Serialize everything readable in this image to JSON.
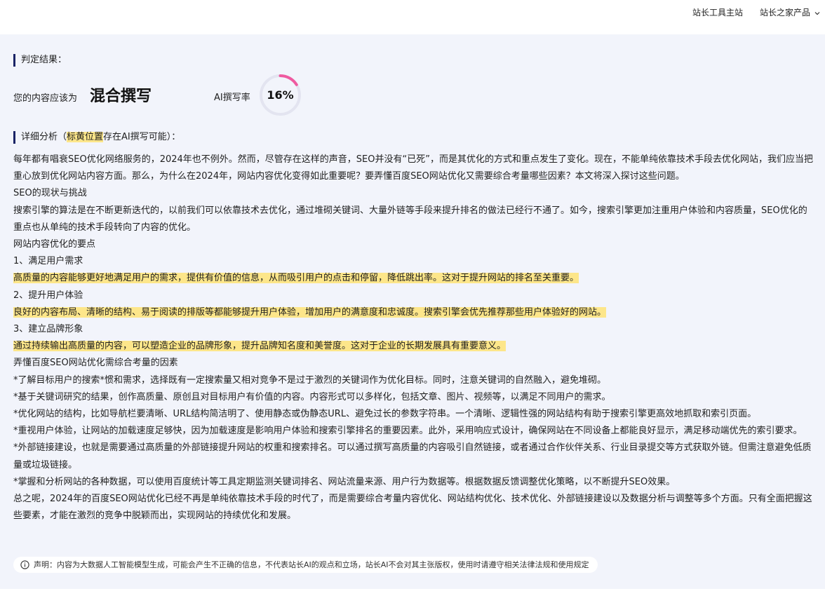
{
  "topnav": {
    "items": [
      {
        "label": "站长工具主站"
      },
      {
        "label": "站长之家产品"
      }
    ]
  },
  "result": {
    "section_label": "判定结果：",
    "prefix": "您的内容应该为",
    "verdict": "混合撰写",
    "ai_rate_label": "AI撰写率",
    "ai_rate_value": "16%",
    "ai_rate_fraction": 0.16
  },
  "analysis": {
    "label_before": "详细分析（",
    "label_highlight": "标黄位置",
    "label_after": "存在AI撰写可能）："
  },
  "paragraphs": [
    {
      "text": "每年都有唱衰SEO优化网络服务的，2024年也不例外。然而，尽管存在这样的声音，SEO并没有“已死”，而是其优化的方式和重点发生了变化。现在，不能单纯依靠技术手段去优化网站，我们应当把重心放到优化网站内容方面。那么，为什么在2024年，网站内容优化变得如此重要呢？要弄懂百度SEO网站优化又需要综合考量哪些因素？本文将深入探讨这些问题。",
      "highlight": false
    },
    {
      "text": "SEO的现状与挑战",
      "highlight": false
    },
    {
      "text": "搜索引擎的算法是在不断更新迭代的，以前我们可以依靠技术去优化，通过堆砌关键词、大量外链等手段来提升排名的做法已经行不通了。如今，搜索引擎更加注重用户体验和内容质量，SEO优化的重点也从单纯的技术手段转向了内容的优化。",
      "highlight": false
    },
    {
      "text": "网站内容优化的要点",
      "highlight": false
    },
    {
      "text": "1、满足用户需求",
      "highlight": false
    },
    {
      "text": "高质量的内容能够更好地满足用户的需求，提供有价值的信息，从而吸引用户的点击和停留，降低跳出率。这对于提升网站的排名至关重要。",
      "highlight": true
    },
    {
      "text": "2、提升用户体验",
      "highlight": false
    },
    {
      "text": "良好的内容布局、清晰的结构、易于阅读的排版等都能够提升用户体验，增加用户的满意度和忠诚度。搜索引擎会优先推荐那些用户体验好的网站。",
      "highlight": true
    },
    {
      "text": "3、建立品牌形象",
      "highlight": false
    },
    {
      "text": "通过持续输出高质量的内容，可以塑造企业的品牌形象，提升品牌知名度和美誉度。这对于企业的长期发展具有重要意义。",
      "highlight": true
    },
    {
      "text": "弄懂百度SEO网站优化需综合考量的因素",
      "highlight": false
    },
    {
      "text": "*了解目标用户的搜索*惯和需求，选择既有一定搜索量又相对竞争不是过于激烈的关键词作为优化目标。同时，注意关键词的自然融入，避免堆砌。",
      "highlight": false
    },
    {
      "text": "*基于关键词研究的结果，创作高质量、原创且对目标用户有价值的内容。内容形式可以多样化，包括文章、图片、视频等，以满足不同用户的需求。",
      "highlight": false
    },
    {
      "text": "*优化网站的结构，比如导航栏要清晰、URL结构简洁明了、使用静态或伪静态URL、避免过长的参数字符串。一个清晰、逻辑性强的网站结构有助于搜索引擎更高效地抓取和索引页面。",
      "highlight": false
    },
    {
      "text": "*重视用户体验，让网站的加载速度足够快，因为加载速度是影响用户体验和搜索引擎排名的重要因素。此外，采用响应式设计，确保网站在不同设备上都能良好显示，满足移动端优先的索引要求。",
      "highlight": false
    },
    {
      "text": "*外部链接建设，也就是需要通过高质量的外部链接提升网站的权重和搜索排名。可以通过撰写高质量的内容吸引自然链接，或者通过合作伙伴关系、行业目录提交等方式获取外链。但需注意避免低质量或垃圾链接。",
      "highlight": false
    },
    {
      "text": "*掌握和分析网站的各种数据，可以使用百度统计等工具定期监测关键词排名、网站流量来源、用户行为数据等。根据数据反馈调整优化策略，以不断提升SEO效果。",
      "highlight": false
    },
    {
      "text": "总之呢，2024年的百度SEO网站优化已经不再是单纯依靠技术手段的时代了，而是需要综合考量内容优化、网站结构优化、技术优化、外部链接建设以及数据分析与调整等多个方面。只有全面把握这些要素，才能在激烈的竞争中脱颖而出，实现网站的持续优化和发展。",
      "highlight": false
    }
  ],
  "disclaimer": {
    "icon": "info-icon",
    "text": "声明：内容为大数据人工智能模型生成，可能会产生不正确的信息，不代表站长AI的观点和立场，站长AI不会对其主张版权，使用时请遵守相关法律法规和使用规定"
  },
  "colors": {
    "highlight": "#fde68a",
    "accent": "#1a2366",
    "gauge_track": "#e3e4f0",
    "gauge_arc": "#ef5aa0"
  }
}
